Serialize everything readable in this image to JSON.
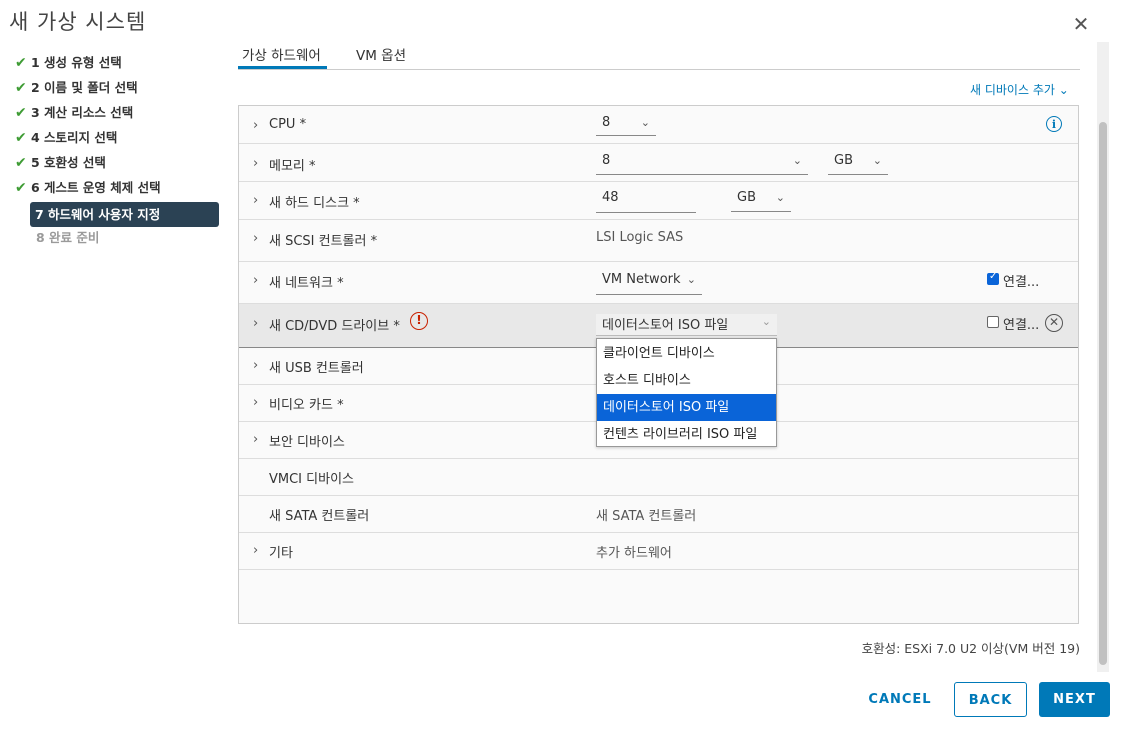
{
  "window": {
    "title": "새 가상 시스템"
  },
  "steps": [
    {
      "label": "1 생성 유형 선택",
      "state": "done"
    },
    {
      "label": "2 이름 및 폴더 선택",
      "state": "done"
    },
    {
      "label": "3 계산 리소스 선택",
      "state": "done"
    },
    {
      "label": "4 스토리지 선택",
      "state": "done"
    },
    {
      "label": "5 호환성 선택",
      "state": "done"
    },
    {
      "label": "6 게스트 운영 체제 선택",
      "state": "done"
    },
    {
      "label": "7 하드웨어 사용자 지정",
      "state": "active"
    },
    {
      "label": "8 완료 준비",
      "state": "disabled"
    }
  ],
  "tabs": [
    {
      "label": "가상 하드웨어",
      "active": true
    },
    {
      "label": "VM 옵션",
      "active": false
    }
  ],
  "add_device_label": "새 디바이스 추가 ⌄",
  "hardware": {
    "cpu": {
      "label": "CPU *",
      "value": "8"
    },
    "memory": {
      "label": "메모리 *",
      "value": "8",
      "unit": "GB"
    },
    "disk": {
      "label": "새 하드 디스크 *",
      "value": "48",
      "unit": "GB"
    },
    "scsi": {
      "label": "새 SCSI 컨트롤러 *",
      "value": "LSI Logic SAS"
    },
    "network": {
      "label": "새 네트워크 *",
      "value": "VM Network",
      "connect_label": "연결...",
      "connected": true
    },
    "cddvd": {
      "label": "새 CD/DVD 드라이브 *",
      "value": "데이터스토어 ISO 파일",
      "connect_label": "연결...",
      "connected": false
    },
    "usb": {
      "label": "새 USB 컨트롤러"
    },
    "video": {
      "label": "비디오 카드 *"
    },
    "security": {
      "label": "보안 디바이스"
    },
    "vmci": {
      "label": "VMCI 디바이스"
    },
    "sata": {
      "label": "새 SATA 컨트롤러",
      "value": "새 SATA 컨트롤러"
    },
    "other": {
      "label": "기타",
      "value": "추가 하드웨어"
    }
  },
  "cd_dropdown_options": [
    {
      "label": "클라이언트 디바이스",
      "selected": false
    },
    {
      "label": "호스트 디바이스",
      "selected": false
    },
    {
      "label": "데이터스토어 ISO 파일",
      "selected": true
    },
    {
      "label": "컨텐츠 라이브러리 ISO 파일",
      "selected": false
    }
  ],
  "compatibility": "호환성: ESXi 7.0 U2 이상(VM 버전 19)",
  "buttons": {
    "cancel": "CANCEL",
    "back": "BACK",
    "next": "NEXT"
  },
  "colors": {
    "accent": "#0079b8",
    "check": "#3f9c35",
    "active_step_bg": "#2b4254",
    "error": "#c92100",
    "selected_option": "#0a64d8"
  }
}
